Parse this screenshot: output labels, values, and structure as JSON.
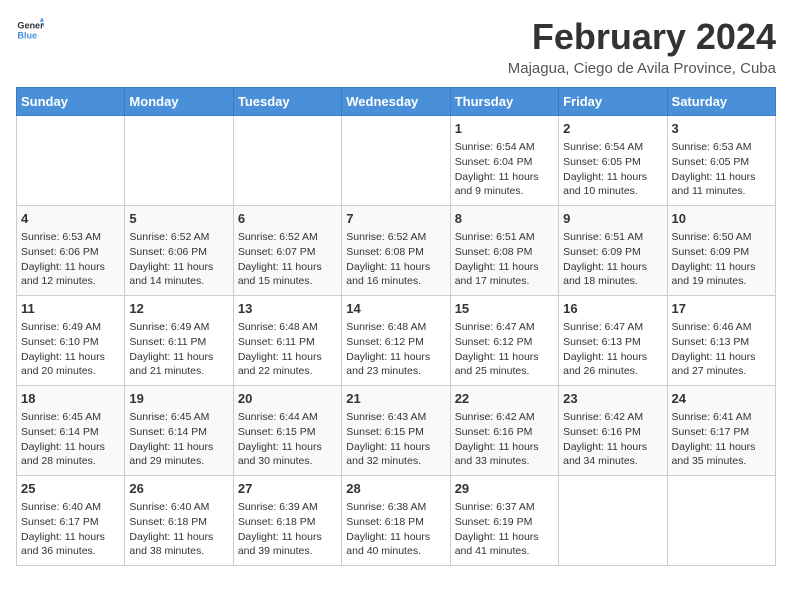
{
  "logo": {
    "general": "General",
    "blue": "Blue"
  },
  "title": {
    "month_year": "February 2024",
    "location": "Majagua, Ciego de Avila Province, Cuba"
  },
  "headers": [
    "Sunday",
    "Monday",
    "Tuesday",
    "Wednesday",
    "Thursday",
    "Friday",
    "Saturday"
  ],
  "weeks": [
    [
      {
        "day": "",
        "info": ""
      },
      {
        "day": "",
        "info": ""
      },
      {
        "day": "",
        "info": ""
      },
      {
        "day": "",
        "info": ""
      },
      {
        "day": "1",
        "info": "Sunrise: 6:54 AM\nSunset: 6:04 PM\nDaylight: 11 hours and 9 minutes."
      },
      {
        "day": "2",
        "info": "Sunrise: 6:54 AM\nSunset: 6:05 PM\nDaylight: 11 hours and 10 minutes."
      },
      {
        "day": "3",
        "info": "Sunrise: 6:53 AM\nSunset: 6:05 PM\nDaylight: 11 hours and 11 minutes."
      }
    ],
    [
      {
        "day": "4",
        "info": "Sunrise: 6:53 AM\nSunset: 6:06 PM\nDaylight: 11 hours and 12 minutes."
      },
      {
        "day": "5",
        "info": "Sunrise: 6:52 AM\nSunset: 6:06 PM\nDaylight: 11 hours and 14 minutes."
      },
      {
        "day": "6",
        "info": "Sunrise: 6:52 AM\nSunset: 6:07 PM\nDaylight: 11 hours and 15 minutes."
      },
      {
        "day": "7",
        "info": "Sunrise: 6:52 AM\nSunset: 6:08 PM\nDaylight: 11 hours and 16 minutes."
      },
      {
        "day": "8",
        "info": "Sunrise: 6:51 AM\nSunset: 6:08 PM\nDaylight: 11 hours and 17 minutes."
      },
      {
        "day": "9",
        "info": "Sunrise: 6:51 AM\nSunset: 6:09 PM\nDaylight: 11 hours and 18 minutes."
      },
      {
        "day": "10",
        "info": "Sunrise: 6:50 AM\nSunset: 6:09 PM\nDaylight: 11 hours and 19 minutes."
      }
    ],
    [
      {
        "day": "11",
        "info": "Sunrise: 6:49 AM\nSunset: 6:10 PM\nDaylight: 11 hours and 20 minutes."
      },
      {
        "day": "12",
        "info": "Sunrise: 6:49 AM\nSunset: 6:11 PM\nDaylight: 11 hours and 21 minutes."
      },
      {
        "day": "13",
        "info": "Sunrise: 6:48 AM\nSunset: 6:11 PM\nDaylight: 11 hours and 22 minutes."
      },
      {
        "day": "14",
        "info": "Sunrise: 6:48 AM\nSunset: 6:12 PM\nDaylight: 11 hours and 23 minutes."
      },
      {
        "day": "15",
        "info": "Sunrise: 6:47 AM\nSunset: 6:12 PM\nDaylight: 11 hours and 25 minutes."
      },
      {
        "day": "16",
        "info": "Sunrise: 6:47 AM\nSunset: 6:13 PM\nDaylight: 11 hours and 26 minutes."
      },
      {
        "day": "17",
        "info": "Sunrise: 6:46 AM\nSunset: 6:13 PM\nDaylight: 11 hours and 27 minutes."
      }
    ],
    [
      {
        "day": "18",
        "info": "Sunrise: 6:45 AM\nSunset: 6:14 PM\nDaylight: 11 hours and 28 minutes."
      },
      {
        "day": "19",
        "info": "Sunrise: 6:45 AM\nSunset: 6:14 PM\nDaylight: 11 hours and 29 minutes."
      },
      {
        "day": "20",
        "info": "Sunrise: 6:44 AM\nSunset: 6:15 PM\nDaylight: 11 hours and 30 minutes."
      },
      {
        "day": "21",
        "info": "Sunrise: 6:43 AM\nSunset: 6:15 PM\nDaylight: 11 hours and 32 minutes."
      },
      {
        "day": "22",
        "info": "Sunrise: 6:42 AM\nSunset: 6:16 PM\nDaylight: 11 hours and 33 minutes."
      },
      {
        "day": "23",
        "info": "Sunrise: 6:42 AM\nSunset: 6:16 PM\nDaylight: 11 hours and 34 minutes."
      },
      {
        "day": "24",
        "info": "Sunrise: 6:41 AM\nSunset: 6:17 PM\nDaylight: 11 hours and 35 minutes."
      }
    ],
    [
      {
        "day": "25",
        "info": "Sunrise: 6:40 AM\nSunset: 6:17 PM\nDaylight: 11 hours and 36 minutes."
      },
      {
        "day": "26",
        "info": "Sunrise: 6:40 AM\nSunset: 6:18 PM\nDaylight: 11 hours and 38 minutes."
      },
      {
        "day": "27",
        "info": "Sunrise: 6:39 AM\nSunset: 6:18 PM\nDaylight: 11 hours and 39 minutes."
      },
      {
        "day": "28",
        "info": "Sunrise: 6:38 AM\nSunset: 6:18 PM\nDaylight: 11 hours and 40 minutes."
      },
      {
        "day": "29",
        "info": "Sunrise: 6:37 AM\nSunset: 6:19 PM\nDaylight: 11 hours and 41 minutes."
      },
      {
        "day": "",
        "info": ""
      },
      {
        "day": "",
        "info": ""
      }
    ]
  ]
}
